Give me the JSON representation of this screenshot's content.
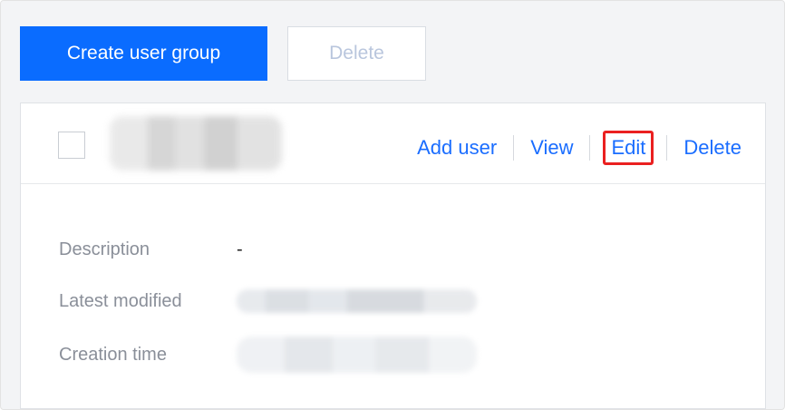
{
  "toolbar": {
    "create_label": "Create user group",
    "delete_label": "Delete"
  },
  "card": {
    "actions": {
      "add_user": "Add user",
      "view": "View",
      "edit": "Edit",
      "delete": "Delete"
    },
    "fields": {
      "description_label": "Description",
      "description_value": "-",
      "latest_modified_label": "Latest modified",
      "creation_time_label": "Creation time"
    }
  },
  "colors": {
    "primary": "#0a6cff",
    "link": "#1a6dff",
    "highlight": "#ea2020"
  }
}
